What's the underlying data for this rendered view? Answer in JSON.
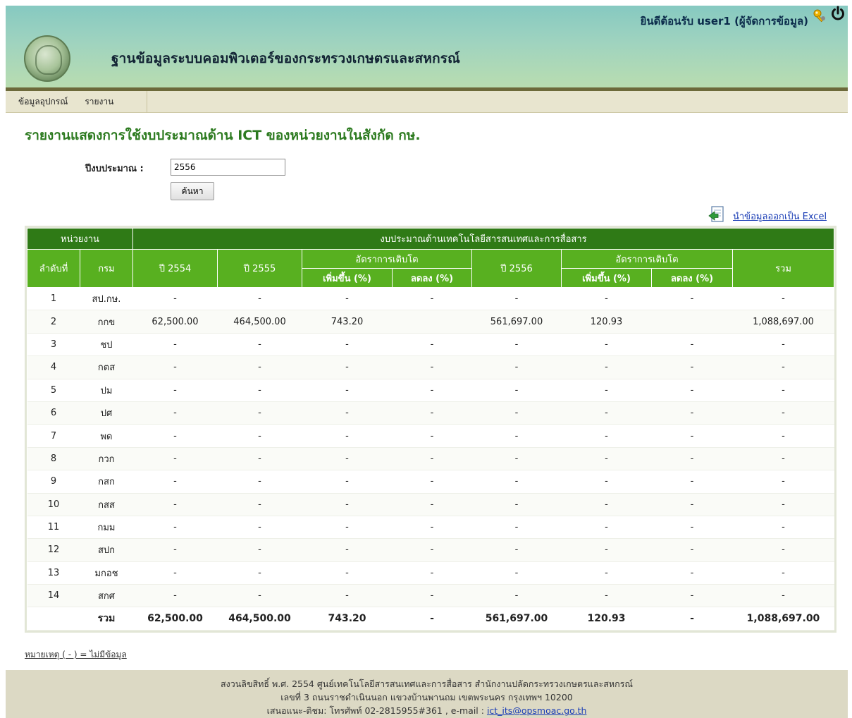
{
  "header": {
    "site_title": "ฐานข้อมูลระบบคอมพิวเตอร์ของกระทรวงเกษตรและสหกรณ์",
    "welcome": "ยินดีต้อนรับ user1 (ผู้จัดการข้อมูล)"
  },
  "menu": {
    "items": [
      "ข้อมูลอุปกรณ์",
      "รายงาน"
    ]
  },
  "page": {
    "title": "รายงานแสดงการใช้งบประมาณด้าน ICT ของหน่วยงานในสังกัด กษ."
  },
  "form": {
    "year_label": "ปีงบประมาณ :",
    "year_value": "2556",
    "search_label": "ค้นหา"
  },
  "export": {
    "label": "นำข้อมูลออกเป็น Excel"
  },
  "table": {
    "group_headers": {
      "unit": "หน่วยงาน",
      "budget": "งบประมาณด้านเทคโนโลยีสารสนเทศและการสื่อสาร"
    },
    "headers": {
      "no": "ลำดับที่",
      "dept": "กรม",
      "y2554": "ปี 2554",
      "y2555": "ปี 2555",
      "growth1": "อัตราการเติบโต",
      "inc1": "เพิ่มขึ้น (%)",
      "dec1": "ลดลง (%)",
      "y2556": "ปี 2556",
      "growth2": "อัตราการเติบโต",
      "inc2": "เพิ่มขึ้น (%)",
      "dec2": "ลดลง (%)",
      "total": "รวม"
    },
    "rows": [
      {
        "no": "1",
        "dept": "สป.กษ.",
        "y2554": "-",
        "y2555": "-",
        "inc1": "-",
        "dec1": "-",
        "y2556": "-",
        "inc2": "-",
        "dec2": "-",
        "total": "-"
      },
      {
        "no": "2",
        "dept": "กกข",
        "y2554": "62,500.00",
        "y2555": "464,500.00",
        "inc1": "743.20",
        "dec1": "",
        "y2556": "561,697.00",
        "inc2": "120.93",
        "dec2": "",
        "total": "1,088,697.00"
      },
      {
        "no": "3",
        "dept": "ชป",
        "y2554": "-",
        "y2555": "-",
        "inc1": "-",
        "dec1": "-",
        "y2556": "-",
        "inc2": "-",
        "dec2": "-",
        "total": "-"
      },
      {
        "no": "4",
        "dept": "กตส",
        "y2554": "-",
        "y2555": "-",
        "inc1": "-",
        "dec1": "-",
        "y2556": "-",
        "inc2": "-",
        "dec2": "-",
        "total": "-"
      },
      {
        "no": "5",
        "dept": "ปม",
        "y2554": "-",
        "y2555": "-",
        "inc1": "-",
        "dec1": "-",
        "y2556": "-",
        "inc2": "-",
        "dec2": "-",
        "total": "-"
      },
      {
        "no": "6",
        "dept": "ปศ",
        "y2554": "-",
        "y2555": "-",
        "inc1": "-",
        "dec1": "-",
        "y2556": "-",
        "inc2": "-",
        "dec2": "-",
        "total": "-"
      },
      {
        "no": "7",
        "dept": "พด",
        "y2554": "-",
        "y2555": "-",
        "inc1": "-",
        "dec1": "-",
        "y2556": "-",
        "inc2": "-",
        "dec2": "-",
        "total": "-"
      },
      {
        "no": "8",
        "dept": "กวก",
        "y2554": "-",
        "y2555": "-",
        "inc1": "-",
        "dec1": "-",
        "y2556": "-",
        "inc2": "-",
        "dec2": "-",
        "total": "-"
      },
      {
        "no": "9",
        "dept": "กสก",
        "y2554": "-",
        "y2555": "-",
        "inc1": "-",
        "dec1": "-",
        "y2556": "-",
        "inc2": "-",
        "dec2": "-",
        "total": "-"
      },
      {
        "no": "10",
        "dept": "กสส",
        "y2554": "-",
        "y2555": "-",
        "inc1": "-",
        "dec1": "-",
        "y2556": "-",
        "inc2": "-",
        "dec2": "-",
        "total": "-"
      },
      {
        "no": "11",
        "dept": "กมม",
        "y2554": "-",
        "y2555": "-",
        "inc1": "-",
        "dec1": "-",
        "y2556": "-",
        "inc2": "-",
        "dec2": "-",
        "total": "-"
      },
      {
        "no": "12",
        "dept": "สปก",
        "y2554": "-",
        "y2555": "-",
        "inc1": "-",
        "dec1": "-",
        "y2556": "-",
        "inc2": "-",
        "dec2": "-",
        "total": "-"
      },
      {
        "no": "13",
        "dept": "มกอช",
        "y2554": "-",
        "y2555": "-",
        "inc1": "-",
        "dec1": "-",
        "y2556": "-",
        "inc2": "-",
        "dec2": "-",
        "total": "-"
      },
      {
        "no": "14",
        "dept": "สกศ",
        "y2554": "-",
        "y2555": "-",
        "inc1": "-",
        "dec1": "-",
        "y2556": "-",
        "inc2": "-",
        "dec2": "-",
        "total": "-"
      }
    ],
    "total_row": {
      "no": "",
      "dept": "รวม",
      "y2554": "62,500.00",
      "y2555": "464,500.00",
      "inc1": "743.20",
      "dec1": "-",
      "y2556": "561,697.00",
      "inc2": "120.93",
      "dec2": "-",
      "total": "1,088,697.00"
    }
  },
  "note": "หมายเหตุ ( - ) = ไม่มีข้อมูล",
  "footer": {
    "line1": "สงวนลิขสิทธิ์ พ.ศ. 2554 ศูนย์เทคโนโลยีสารสนเทศและการสื่อสาร สำนักงานปลัดกระทรวงเกษตรและสหกรณ์",
    "line2": "เลขที่ 3 ถนนราชดำเนินนอก แขวงบ้านพานถม เขตพระนคร กรุงเทพฯ 10200",
    "line3_prefix": "เสนอแนะ-ติชม: โทรศัพท์ 02-2815955#361 , e-mail :",
    "email": "ict_its@opsmoac.go.th"
  },
  "colors": {
    "header_dark": "#2f7a16",
    "header_light": "#58b020",
    "title_green": "#2c7a1f",
    "link_blue": "#1a3db5"
  }
}
